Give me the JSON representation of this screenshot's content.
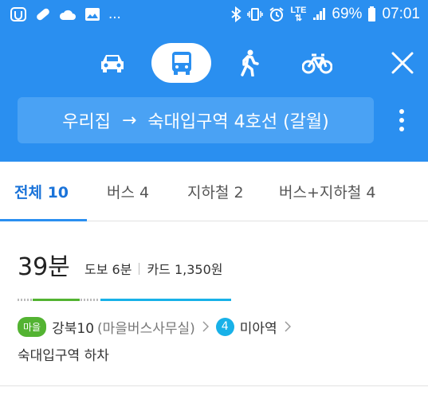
{
  "status_bar": {
    "left_icons": [
      "app-notification-icon",
      "pill-icon",
      "cloud-icon",
      "image-icon"
    ],
    "ellipsis": "...",
    "right_icons": [
      "bluetooth-icon",
      "vibrate-icon",
      "alarm-icon",
      "lte-icon",
      "signal-icon",
      "battery-icon"
    ],
    "lte_label": "LTE",
    "battery_percent": "69%",
    "time": "07:01"
  },
  "transport_modes": {
    "items": [
      {
        "name": "car",
        "icon": "car-icon",
        "active": false
      },
      {
        "name": "bus",
        "icon": "bus-icon",
        "active": true
      },
      {
        "name": "walk",
        "icon": "walk-icon",
        "active": false
      },
      {
        "name": "bike",
        "icon": "bike-icon",
        "active": false
      }
    ],
    "close_icon": "close-icon"
  },
  "route": {
    "origin": "우리집",
    "arrow": "→",
    "destination": "숙대입구역 4호선 (갈월)"
  },
  "tabs": [
    {
      "label": "전체 10",
      "active": true
    },
    {
      "label": "버스 4",
      "active": false
    },
    {
      "label": "지하철 2",
      "active": false
    },
    {
      "label": "버스+지하철 4",
      "active": false
    }
  ],
  "result": {
    "duration": "39분",
    "walk": "도보 6분",
    "fare": "카드 1,350원",
    "bus_badge": "마을",
    "bus_name": "강북10",
    "bus_detail": "(마을버스사무실)",
    "line_number": "4",
    "station": "미아역",
    "alight": "숙대입구역 하차"
  },
  "colors": {
    "header": "#2a8ff0",
    "village_bus": "#53b332",
    "line4": "#18b1e8",
    "active_tab": "#1a73d9"
  }
}
